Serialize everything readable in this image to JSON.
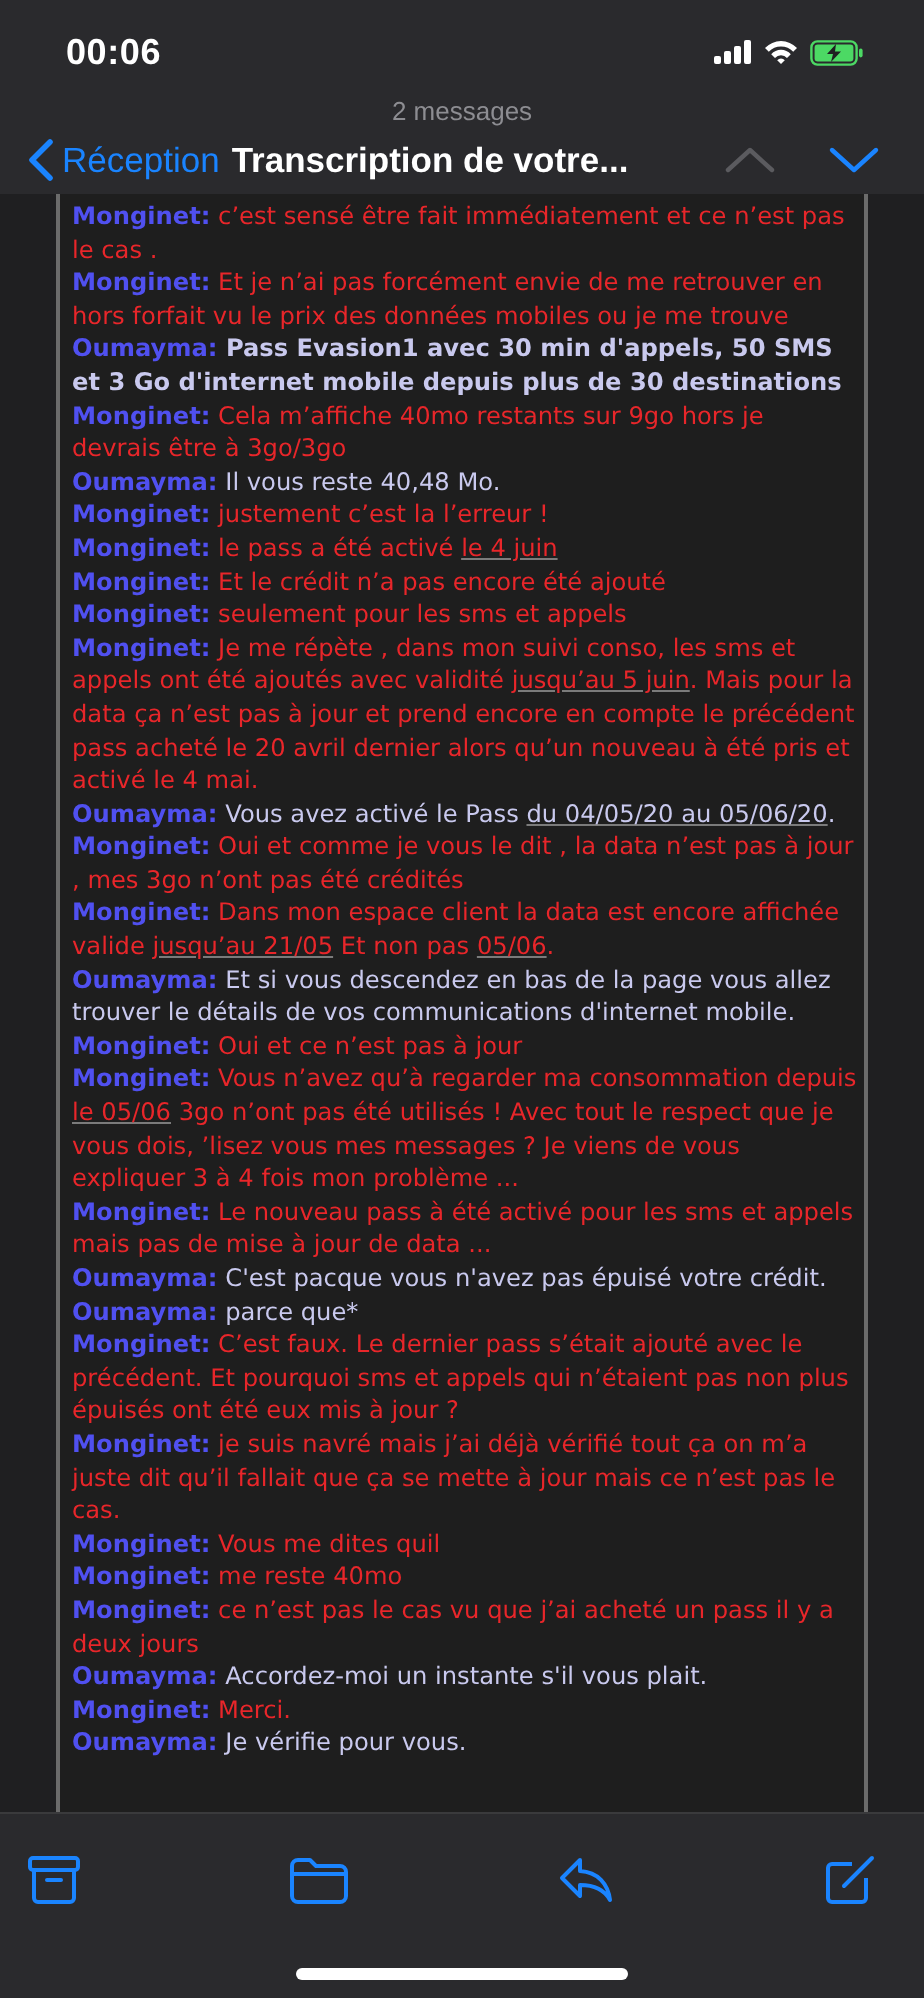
{
  "status_bar": {
    "time": "00:06"
  },
  "nav": {
    "count": "2 messages",
    "back": "Réception",
    "title": "Transcription de votre...",
    "arrows": [
      {
        "kind": "up",
        "disabled": true
      },
      {
        "kind": "down",
        "disabled": false
      }
    ]
  },
  "messages": [
    {
      "sender": "Monginet:",
      "kind": "customer",
      "parts": [
        {
          "kind": "text",
          "text": "c’est sensé être fait immédiatement et ce n’est pas le cas ."
        }
      ]
    },
    {
      "sender": "Monginet:",
      "kind": "customer",
      "parts": [
        {
          "kind": "text",
          "text": "Et je n’ai pas forcément envie de me retrouver en hors forfait vu le prix des données mobiles ou je me trouve"
        }
      ]
    },
    {
      "sender": "Oumayma:",
      "kind": "agent",
      "bold": true,
      "parts": [
        {
          "kind": "text",
          "text": "Pass Evasion1 avec 30 min d'appels, 50 SMS et 3 Go d'internet mobile depuis plus de 30 destinations"
        }
      ]
    },
    {
      "sender": "Monginet:",
      "kind": "customer",
      "parts": [
        {
          "kind": "text",
          "text": "Cela m’affiche 40mo restants sur 9go hors je devrais être à 3go/3go"
        }
      ]
    },
    {
      "sender": "Oumayma:",
      "kind": "agent",
      "parts": [
        {
          "kind": "text",
          "text": "Il vous reste 40,48 Mo."
        }
      ]
    },
    {
      "sender": "Monginet:",
      "kind": "customer",
      "parts": [
        {
          "kind": "text",
          "text": "justement c’est la l’erreur !"
        }
      ]
    },
    {
      "sender": "Monginet:",
      "kind": "customer",
      "parts": [
        {
          "kind": "text",
          "text": "le pass a été activé "
        },
        {
          "kind": "link",
          "text": "le 4 juin"
        }
      ]
    },
    {
      "sender": "Monginet:",
      "kind": "customer",
      "parts": [
        {
          "kind": "text",
          "text": "Et le crédit n’a pas encore été ajouté"
        }
      ]
    },
    {
      "sender": "Monginet:",
      "kind": "customer",
      "parts": [
        {
          "kind": "text",
          "text": "seulement pour les sms et appels"
        }
      ]
    },
    {
      "sender": "Monginet:",
      "kind": "customer",
      "parts": [
        {
          "kind": "text",
          "text": "Je me répète , dans mon suivi conso, les sms et appels ont été ajoutés avec validité "
        },
        {
          "kind": "link",
          "text": "jusqu’au 5 juin"
        },
        {
          "kind": "text",
          "text": ". Mais pour la data ça n’est pas à jour et prend encore en compte le précédent pass acheté le 20 avril dernier alors qu’un nouveau à été pris et activé le 4 mai."
        }
      ]
    },
    {
      "sender": "Oumayma:",
      "kind": "agent",
      "parts": [
        {
          "kind": "text",
          "text": "Vous avez activé le Pass "
        },
        {
          "kind": "link",
          "text": "du 04/05/20 au 05/06/20"
        },
        {
          "kind": "text",
          "text": "."
        }
      ]
    },
    {
      "sender": "Monginet:",
      "kind": "customer",
      "parts": [
        {
          "kind": "text",
          "text": "Oui et comme je vous le dit , la data n’est pas à jour , mes 3go n’ont pas été crédités"
        }
      ]
    },
    {
      "sender": "Monginet:",
      "kind": "customer",
      "parts": [
        {
          "kind": "text",
          "text": "Dans mon espace client la data est encore affichée valide "
        },
        {
          "kind": "link",
          "text": "jusqu’au 21/05"
        },
        {
          "kind": "text",
          "text": " Et non pas "
        },
        {
          "kind": "link",
          "text": "05/06"
        },
        {
          "kind": "text",
          "text": "."
        }
      ]
    },
    {
      "sender": "Oumayma:",
      "kind": "agent",
      "parts": [
        {
          "kind": "text",
          "text": "Et si vous descendez en bas de la page vous allez trouver le détails de vos communications d'internet mobile."
        }
      ]
    },
    {
      "sender": "Monginet:",
      "kind": "customer",
      "parts": [
        {
          "kind": "text",
          "text": "Oui et ce n’est pas à jour"
        }
      ]
    },
    {
      "sender": "Monginet:",
      "kind": "customer",
      "parts": [
        {
          "kind": "text",
          "text": "Vous n’avez qu’à regarder ma consommation depuis "
        },
        {
          "kind": "link",
          "text": "le 05/06"
        },
        {
          "kind": "text",
          "text": " 3go n’ont pas été utilisés ! Avec tout le respect que je vous dois, ’lisez vous mes messages ? Je viens de vous expliquer 3 à 4 fois mon problème ..."
        }
      ]
    },
    {
      "sender": "Monginet:",
      "kind": "customer",
      "parts": [
        {
          "kind": "text",
          "text": "Le nouveau pass à été activé pour les sms et appels mais pas de mise à jour de data ..."
        }
      ]
    },
    {
      "sender": "Oumayma:",
      "kind": "agent",
      "parts": [
        {
          "kind": "text",
          "text": "C'est pacque vous n'avez pas épuisé votre crédit."
        }
      ]
    },
    {
      "sender": "Oumayma:",
      "kind": "agent",
      "parts": [
        {
          "kind": "text",
          "text": "parce que*"
        }
      ]
    },
    {
      "sender": "Monginet:",
      "kind": "customer",
      "parts": [
        {
          "kind": "text",
          "text": "C’est faux. Le dernier pass s’était ajouté avec le précédent. Et pourquoi sms et appels qui n’étaient pas non plus épuisés ont été eux mis à jour ?"
        }
      ]
    },
    {
      "sender": "Monginet:",
      "kind": "customer",
      "parts": [
        {
          "kind": "text",
          "text": "je suis navré mais j’ai déjà vérifié tout ça on m’a juste dit qu’il fallait que ça se mette à jour mais ce n’est pas le cas."
        }
      ]
    },
    {
      "sender": "Monginet:",
      "kind": "customer",
      "parts": [
        {
          "kind": "text",
          "text": "Vous me dites quil"
        }
      ]
    },
    {
      "sender": "Monginet:",
      "kind": "customer",
      "parts": [
        {
          "kind": "text",
          "text": "me reste 40mo"
        }
      ]
    },
    {
      "sender": "Monginet:",
      "kind": "customer",
      "parts": [
        {
          "kind": "text",
          "text": "ce n’est pas le cas vu que j’ai acheté un pass il y a deux jours"
        }
      ]
    },
    {
      "sender": "Oumayma:",
      "kind": "agent",
      "parts": [
        {
          "kind": "text",
          "text": "Accordez-moi un instante s'il vous plait."
        }
      ]
    },
    {
      "sender": "Monginet:",
      "kind": "customer",
      "parts": [
        {
          "kind": "text",
          "text": "Merci."
        }
      ]
    },
    {
      "sender": "Oumayma:",
      "kind": "agent",
      "parts": [
        {
          "kind": "text",
          "text": "Je vérifie pour vous."
        }
      ]
    }
  ]
}
